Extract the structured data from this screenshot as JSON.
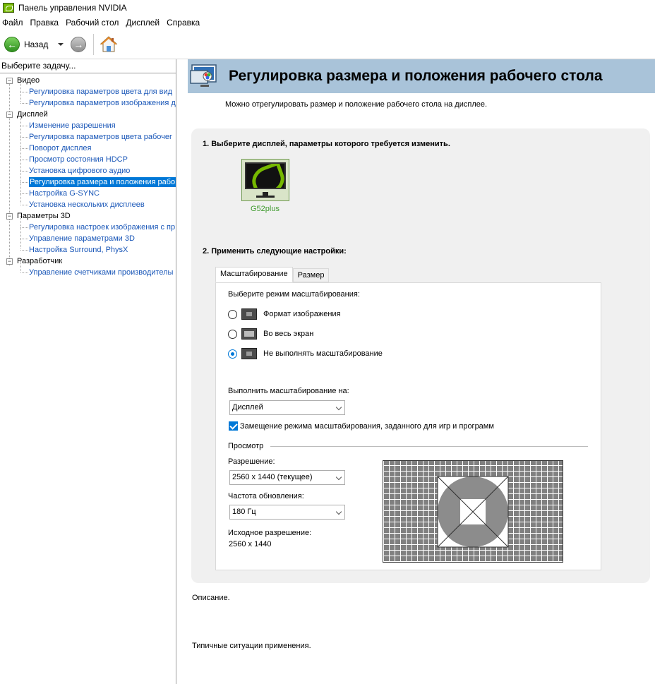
{
  "window": {
    "title": "Панель управления NVIDIA"
  },
  "menu": [
    "Файл",
    "Правка",
    "Рабочий стол",
    "Дисплей",
    "Справка"
  ],
  "toolbar": {
    "back_label": "Назад"
  },
  "sidebar": {
    "header": "Выберите задачу...",
    "categories": [
      {
        "label": "Видео",
        "items": [
          "Регулировка параметров цвета для вид",
          "Регулировка параметров изображения д"
        ]
      },
      {
        "label": "Дисплей",
        "items": [
          "Изменение разрешения",
          "Регулировка параметров цвета рабочег",
          "Поворот дисплея",
          "Просмотр состояния HDCP",
          "Установка цифрового аудио",
          "Регулировка размера и положения рабо",
          "Настройка G-SYNC",
          "Установка нескольких дисплеев"
        ]
      },
      {
        "label": "Параметры 3D",
        "items": [
          "Регулировка настроек изображения с пр",
          "Управление параметрами 3D",
          "Настройка Surround, PhysX"
        ]
      },
      {
        "label": "Разработчик",
        "items": [
          "Управление счетчиками производителы"
        ]
      }
    ],
    "selected": "Регулировка размера и положения рабо"
  },
  "page": {
    "title": "Регулировка размера и положения рабочего стола",
    "description": "Можно отрегулировать размер и положение рабочего стола на дисплее.",
    "step1": "1. Выберите дисплей, параметры которого требуется изменить.",
    "display_name": "G52plus",
    "step2": "2. Применить следующие настройки:",
    "tabs": [
      "Масштабирование",
      "Размер"
    ],
    "scaling": {
      "label": "Выберите режим масштабирования:",
      "options": [
        "Формат изображения",
        "Во весь экран",
        "Не выполнять масштабирование"
      ],
      "selected_index": 2,
      "perform_on_label": "Выполнить масштабирование на:",
      "perform_on_value": "Дисплей",
      "override_label": "Замещение режима масштабирования, заданного для игр и программ",
      "override_checked": true
    },
    "preview": {
      "group_label": "Просмотр",
      "resolution_label": "Разрешение:",
      "resolution_value": "2560 x 1440 (текущее)",
      "refresh_label": "Частота обновления:",
      "refresh_value": "180 Гц",
      "native_label": "Исходное разрешение:",
      "native_value": "2560 x 1440"
    },
    "description_section": "Описание.",
    "usage_section": "Типичные ситуации применения."
  }
}
